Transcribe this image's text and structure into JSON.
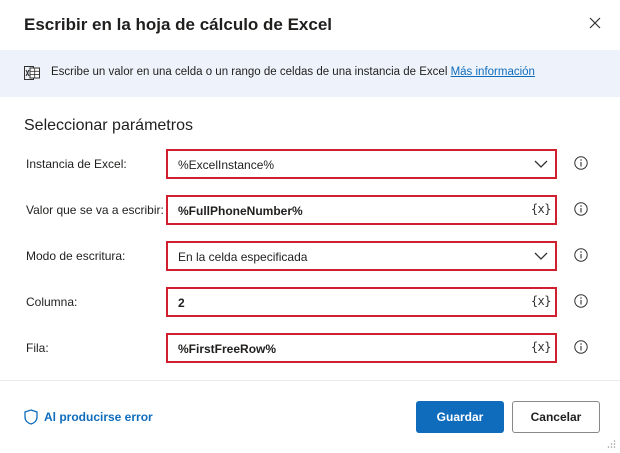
{
  "dialog": {
    "title": "Escribir en la hoja de cálculo de Excel",
    "close_icon": "close-icon"
  },
  "banner": {
    "icon": "excel-icon",
    "text": "Escribe un valor en una celda o un rango de celdas de una instancia de Excel",
    "link": "Más información"
  },
  "section": {
    "title": "Seleccionar parámetros"
  },
  "fields": [
    {
      "label": "Instancia de Excel:",
      "value": "%ExcelInstance%",
      "control": "dropdown"
    },
    {
      "label": "Valor que se va a escribir:",
      "value": "%FullPhoneNumber%",
      "control": "variable"
    },
    {
      "label": "Modo de escritura:",
      "value": "En la celda especificada",
      "control": "dropdown"
    },
    {
      "label": "Columna:",
      "value": "2",
      "control": "variable"
    },
    {
      "label": "Fila:",
      "value": "%FirstFreeRow%",
      "control": "variable"
    }
  ],
  "variable_button": "{x}",
  "footer": {
    "on_error": "Al producirse error",
    "save": "Guardar",
    "cancel": "Cancelar"
  },
  "colors": {
    "accent": "#0f6cbd",
    "highlight_border": "#d01f2f",
    "banner_bg": "#eef3fb"
  }
}
